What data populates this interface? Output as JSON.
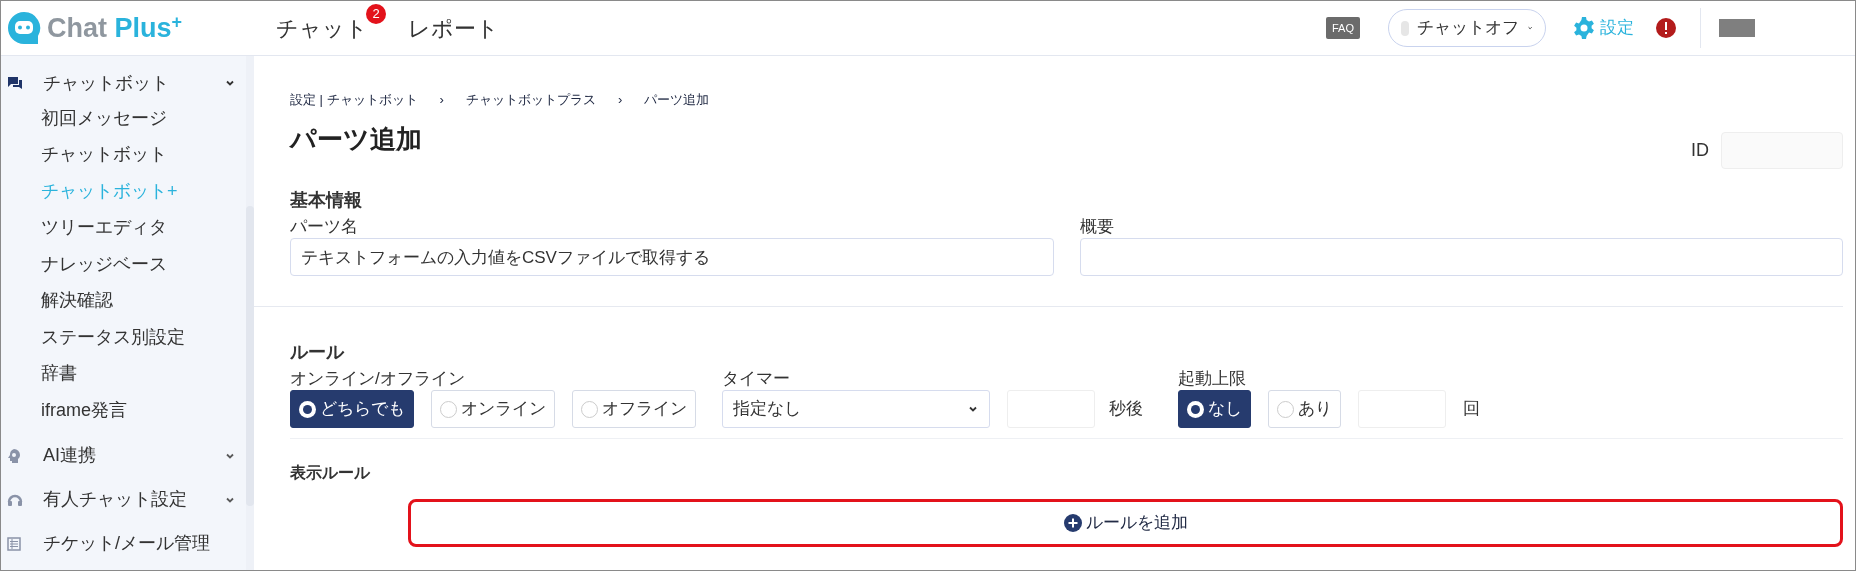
{
  "header": {
    "logo": {
      "name": "Chat",
      "accent": "Plus",
      "sup": "+"
    },
    "nav": [
      {
        "label": "チャット",
        "badge": "2"
      },
      {
        "label": "レポート"
      }
    ],
    "faq": "FAQ",
    "status": {
      "label": "チャットオフ",
      "online": false
    },
    "settings": "設定"
  },
  "breadcrumb_separator": "›",
  "sidebar": {
    "groups": [
      {
        "label": "チャットボット",
        "expanded": true,
        "items": [
          {
            "label": "初回メッセージ",
            "selected": false
          },
          {
            "label": "チャットボット",
            "selected": false
          },
          {
            "label": "チャットボット+",
            "selected": true
          },
          {
            "label": "ツリーエディタ",
            "selected": false
          },
          {
            "label": "ナレッジベース",
            "selected": false
          },
          {
            "label": "解決確認",
            "selected": false
          },
          {
            "label": "ステータス別設定",
            "selected": false
          },
          {
            "label": "辞書",
            "selected": false
          },
          {
            "label": "iframe発言",
            "selected": false
          }
        ]
      },
      {
        "label": "AI連携",
        "expanded": false
      },
      {
        "label": "有人チャット設定",
        "expanded": false
      },
      {
        "label": "チケット/メール管理"
      }
    ]
  },
  "breadcrumb": [
    "設定 | チャットボット",
    "チャットボットプラス",
    "パーツ追加"
  ],
  "title": "パーツ追加",
  "id_label": "ID",
  "basic": {
    "heading": "基本情報",
    "fields": [
      {
        "label": "パーツ名",
        "value": "テキストフォームの入力値をCSVファイルで取得する"
      },
      {
        "label": "概要"
      }
    ]
  },
  "rule": {
    "heading": "ルール",
    "online": {
      "label": "オンライン/オフライン",
      "options": [
        {
          "label": "どちらでも",
          "selected": true
        },
        {
          "label": "オンライン",
          "selected": false
        },
        {
          "label": "オフライン",
          "selected": false
        }
      ]
    },
    "timer": {
      "label": "タイマー",
      "value": "指定なし",
      "unit": "秒後"
    },
    "limit": {
      "label": "起動上限",
      "options": [
        {
          "label": "なし",
          "selected": true
        },
        {
          "label": "あり",
          "selected": false
        }
      ],
      "unit": "回"
    }
  },
  "display_rule": {
    "heading": "表示ルール",
    "add_button": "ルールを追加",
    "highlighted": true
  }
}
